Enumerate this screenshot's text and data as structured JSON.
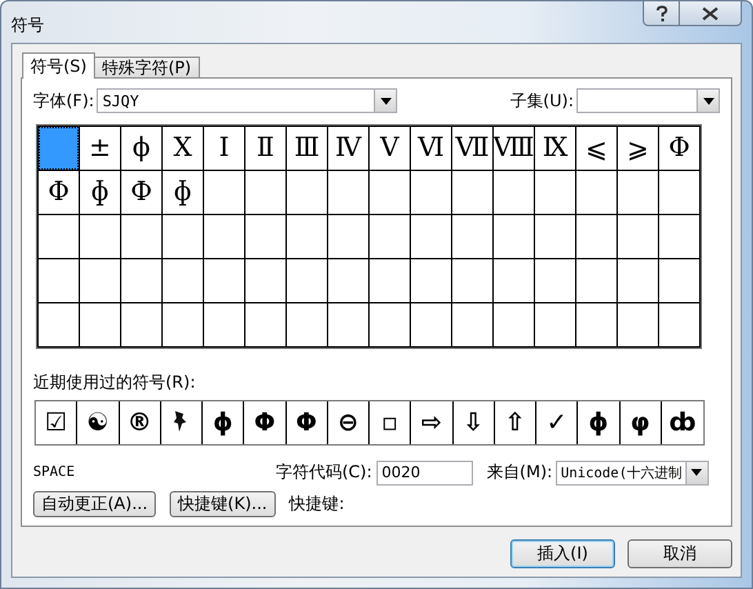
{
  "window": {
    "title": "符号"
  },
  "tabs": [
    {
      "label": "符号(S)",
      "selected": true
    },
    {
      "label": "特殊字符(P)",
      "selected": false
    }
  ],
  "font": {
    "label": "字体(F):",
    "value": "SJQY"
  },
  "subset": {
    "label": "子集(U):"
  },
  "symbol_grid": [
    {
      "selected": true
    },
    {
      "symbol": "±",
      "selected": false
    },
    {
      "symbol": "ϕ",
      "selected": false
    },
    {
      "symbol": "Ⅹ",
      "selected": false
    },
    {
      "symbol": "Ⅰ",
      "selected": false
    },
    {
      "symbol": "Ⅱ",
      "selected": false
    },
    {
      "symbol": "Ⅲ",
      "selected": false
    },
    {
      "symbol": "Ⅳ",
      "selected": false
    },
    {
      "symbol": "Ⅴ",
      "selected": false
    },
    {
      "symbol": "Ⅵ",
      "selected": false
    },
    {
      "symbol": "Ⅶ",
      "selected": false
    },
    {
      "symbol": "Ⅷ",
      "selected": false
    },
    {
      "symbol": "Ⅸ",
      "selected": false
    },
    {
      "symbol": "⩽",
      "selected": false
    },
    {
      "symbol": "⩾",
      "selected": false
    },
    {
      "symbol": "Φ",
      "selected": false
    },
    {
      "symbol": "Φ",
      "selected": false
    },
    {
      "symbol": "ɸ",
      "selected": false
    },
    {
      "symbol": "Ф",
      "selected": false
    },
    {
      "symbol": "ɸ",
      "selected": false
    }
  ],
  "recent": {
    "label": "近期使用过的符号(R):",
    "symbols": [
      {
        "kind": "glyph",
        "symbol": "☑"
      },
      {
        "kind": "glyph",
        "symbol": "☯"
      },
      {
        "kind": "glyph",
        "symbol": "®"
      },
      {
        "kind": "pin"
      },
      {
        "kind": "glyph",
        "symbol": "ɸ"
      },
      {
        "kind": "glyph",
        "symbol": "Φ"
      },
      {
        "kind": "glyph",
        "symbol": "Φ"
      },
      {
        "kind": "glyph",
        "symbol": "⊖"
      },
      {
        "kind": "glyph",
        "symbol": "▫"
      },
      {
        "kind": "glyph",
        "symbol": "⇨"
      },
      {
        "kind": "glyph",
        "symbol": "⇩"
      },
      {
        "kind": "glyph",
        "symbol": "⇧"
      },
      {
        "kind": "glyph",
        "symbol": "✓"
      },
      {
        "kind": "glyph",
        "symbol": "ɸ"
      },
      {
        "kind": "glyph",
        "symbol": "φ"
      },
      {
        "kind": "glyph",
        "symbol": "ȸ"
      }
    ]
  },
  "char_name": "SPACE",
  "char_code": {
    "label": "字符代码(C):",
    "value": "0020"
  },
  "from": {
    "label": "来自(M):",
    "value": "Unicode(十六进制"
  },
  "buttons": [
    {
      "label": "自动更正(A)..."
    },
    {
      "label": "快捷键(K)..."
    }
  ],
  "shortcut_label": "快捷键:",
  "footer_buttons": [
    {
      "label": "插入(I)",
      "default": true
    },
    {
      "label": "取消",
      "default": false
    }
  ]
}
